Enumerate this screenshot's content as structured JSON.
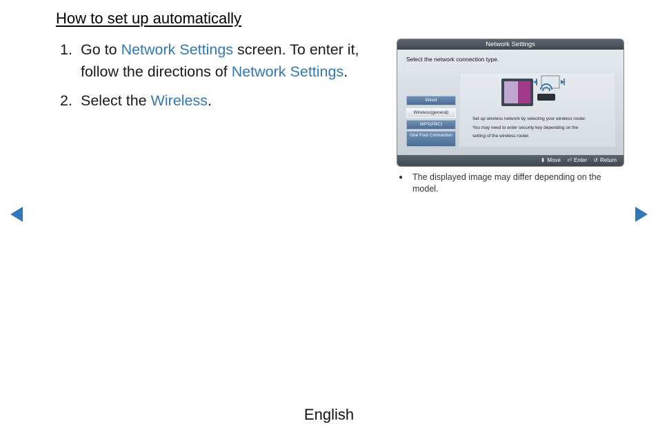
{
  "heading": "How to set up automatically",
  "steps": [
    {
      "num": "1.",
      "parts": [
        "Go to ",
        "Network Settings",
        " screen. To enter it, follow the directions of ",
        "Network Settings",
        "."
      ]
    },
    {
      "num": "2.",
      "parts": [
        "Select the ",
        "Wireless",
        "."
      ]
    }
  ],
  "screenshot": {
    "title": "Network Settings",
    "prompt": "Select the network connection type.",
    "options": [
      "Wired",
      "Wireless(general)",
      "WPS(PBC)",
      "One Foot Connection"
    ],
    "selected_option": "Wireless(general)",
    "description": [
      "Set up wireless network by selecting your wireless router.",
      "You may need to enter security key depending on the",
      "setting of the wireless router."
    ],
    "footer": {
      "move": "Move",
      "enter": "Enter",
      "return": "Return"
    }
  },
  "note": "The displayed image may differ depending on the model.",
  "footer": {
    "language": "English"
  },
  "colors": {
    "highlight": "#2f78b9",
    "arrow": "#2f78b9"
  }
}
